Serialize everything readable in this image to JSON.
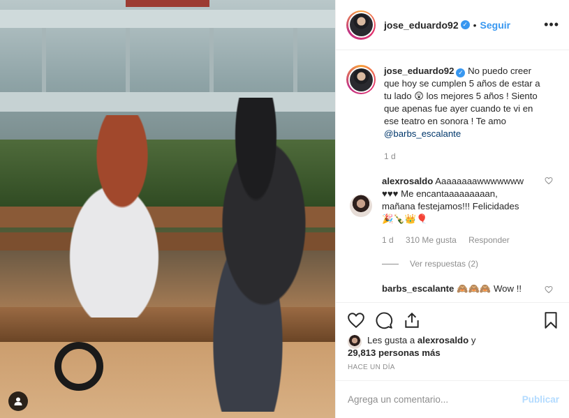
{
  "post": {
    "author": "jose_eduardo92",
    "follow_label": "Seguir",
    "separator": "•",
    "more_label": "•••",
    "caption_author": "jose_eduardo92",
    "caption_text": "No puedo creer que hoy se cumplen 5 años de estar a tu lado 😲 los mejores 5 años ! Siento que apenas fue ayer cuando te vi en ese teatro en sonora ! Te amo",
    "caption_mention": "@barbs_escalante",
    "caption_age": "1 d"
  },
  "comments": [
    {
      "user": "alexrosaldo",
      "text": "Aaaaaaaawwwwwww ♥♥♥ Me encantaaaaaaaaan, mañana festejamos!!! Felicidades 🎉🍾👑🎈",
      "age": "1 d",
      "likes": "310 Me gusta",
      "reply_label": "Responder",
      "view_replies": "Ver respuestas (2)"
    },
    {
      "user": "barbs_escalante",
      "text": "🙈🙈🙈 Wow !!"
    }
  ],
  "likes": {
    "prefix": "Les gusta a",
    "user": "alexrosaldo",
    "conj": "y",
    "count": "29,813 personas más"
  },
  "timestamp": "HACE UN DÍA",
  "comment_box": {
    "placeholder": "Agrega un comentario...",
    "publish_label": "Publicar"
  },
  "colors": {
    "accent": "#3897f0",
    "text": "#262626",
    "muted": "#8e8e8e",
    "publish_disabled": "#b3dbff"
  }
}
